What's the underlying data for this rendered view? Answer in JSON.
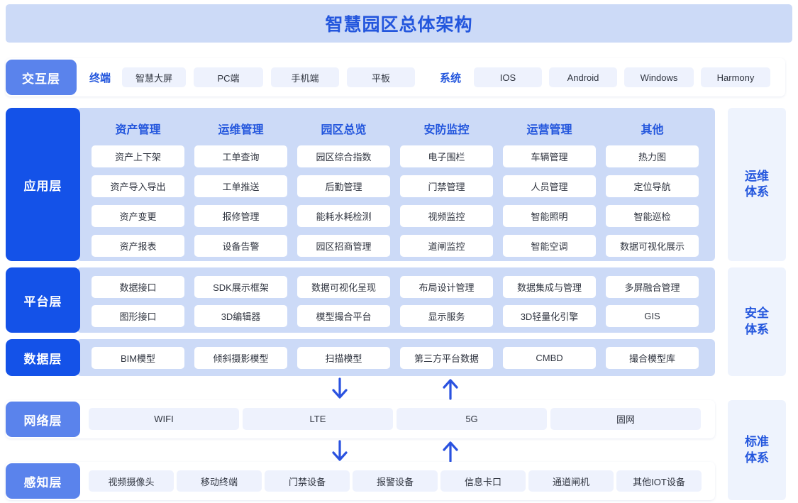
{
  "title": "智慧园区总体架构",
  "colors": {
    "title_bg": "#ccdaf7",
    "title_text": "#2356dd",
    "tab_light": "#5a83ec",
    "tab_dark": "#1452e8",
    "band": "#ccdaf7",
    "pill_pale": "#eef2fd",
    "pill_white": "#ffffff",
    "accent": "#2356dd",
    "arrow": "#2a52e0",
    "side_panel_bg": "#eef3fd"
  },
  "layers": {
    "interaction": {
      "label": "交互层",
      "groups": [
        {
          "label": "终端",
          "items": [
            "智慧大屏",
            "PC端",
            "手机端",
            "平板"
          ]
        },
        {
          "label": "系统",
          "items": [
            "IOS",
            "Android",
            "Windows",
            "Harmony"
          ]
        }
      ]
    },
    "application": {
      "label": "应用层",
      "columns": [
        {
          "header": "资产管理",
          "items": [
            "资产上下架",
            "资产导入导出",
            "资产变更",
            "资产报表"
          ]
        },
        {
          "header": "运维管理",
          "items": [
            "工单查询",
            "工单推送",
            "报修管理",
            "设备告警"
          ]
        },
        {
          "header": "园区总览",
          "items": [
            "园区综合指数",
            "后勤管理",
            "能耗水耗检测",
            "园区招商管理"
          ]
        },
        {
          "header": "安防监控",
          "items": [
            "电子围栏",
            "门禁管理",
            "视频监控",
            "道闸监控"
          ]
        },
        {
          "header": "运营管理",
          "items": [
            "车辆管理",
            "人员管理",
            "智能照明",
            "智能空调"
          ]
        },
        {
          "header": "其他",
          "items": [
            "热力图",
            "定位导航",
            "智能巡检",
            "数据可视化展示"
          ]
        }
      ]
    },
    "platform": {
      "label": "平台层",
      "rows": [
        [
          "数据接口",
          "SDK展示框架",
          "数据可视化呈现",
          "布局设计管理",
          "数据集成与管理",
          "多屏融合管理"
        ],
        [
          "图形接口",
          "3D编辑器",
          "模型撮合平台",
          "显示服务",
          "3D轻量化引擎",
          "GIS"
        ]
      ]
    },
    "data": {
      "label": "数据层",
      "items": [
        "BIM模型",
        "倾斜摄影模型",
        "扫描模型",
        "第三方平台数据",
        "CMBD",
        "撮合模型库"
      ]
    },
    "network": {
      "label": "网络层",
      "items": [
        "WIFI",
        "LTE",
        "5G",
        "固网"
      ]
    },
    "perception": {
      "label": "感知层",
      "items": [
        "视频摄像头",
        "移动终端",
        "门禁设备",
        "报警设备",
        "信息卡口",
        "通道闸机",
        "其他IOT设备"
      ]
    }
  },
  "side_panels": [
    {
      "line1": "运维",
      "line2": "体系"
    },
    {
      "line1": "安全",
      "line2": "体系"
    },
    {
      "line1": "标准",
      "line2": "体系"
    }
  ],
  "arrows": [
    {
      "name": "down-arrow-data-to-network",
      "direction": "down"
    },
    {
      "name": "up-arrow-network-to-data",
      "direction": "up"
    },
    {
      "name": "down-arrow-network-to-perception",
      "direction": "down"
    },
    {
      "name": "up-arrow-perception-to-network",
      "direction": "up"
    }
  ]
}
